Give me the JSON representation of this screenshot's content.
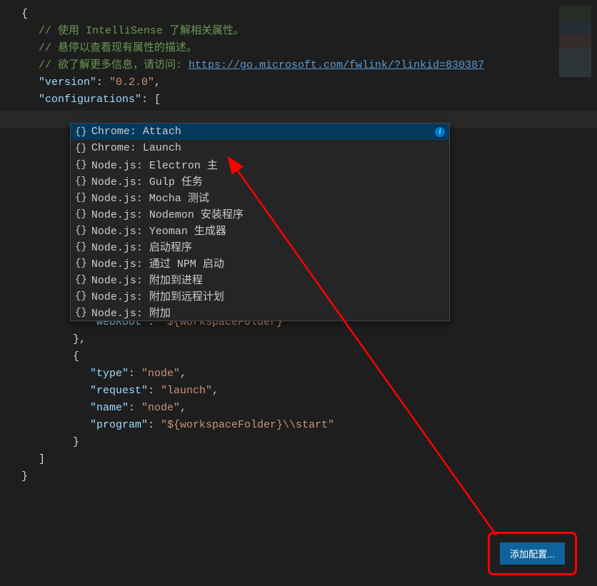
{
  "comments": {
    "line1": "// 使用 IntelliSense 了解相关属性。",
    "line2": "// 悬停以查看现有属性的描述。",
    "line3_prefix": "// 欲了解更多信息，请访问: ",
    "line3_link": "https://go.microsoft.com/fwlink/?linkid=830387"
  },
  "json_keys": {
    "version": "\"version\"",
    "version_val": "\"0.2.0\"",
    "configurations": "\"configurations\"",
    "webRoot": "\"webRoot\"",
    "webRoot_val": "\"${workspaceFolder}\"",
    "type": "\"type\"",
    "type_val": "\"node\"",
    "request": "\"request\"",
    "request_val": "\"launch\"",
    "name": "\"name\"",
    "name_val": "\"node\"",
    "program": "\"program\"",
    "program_val": "\"${workspaceFolder}\\\\start\""
  },
  "suggestions": [
    {
      "icon": "{}",
      "label": "Chrome: Attach",
      "selected": true
    },
    {
      "icon": "{}",
      "label": "Chrome: Launch"
    },
    {
      "icon": "{}",
      "label": "Node.js: Electron 主"
    },
    {
      "icon": "{}",
      "label": "Node.js: Gulp 任务"
    },
    {
      "icon": "{}",
      "label": "Node.js: Mocha 测试"
    },
    {
      "icon": "{}",
      "label": "Node.js: Nodemon 安装程序"
    },
    {
      "icon": "{}",
      "label": "Node.js: Yeoman 生成器"
    },
    {
      "icon": "{}",
      "label": "Node.js: 启动程序"
    },
    {
      "icon": "{}",
      "label": "Node.js: 通过 NPM 启动"
    },
    {
      "icon": "{}",
      "label": "Node.js: 附加到进程"
    },
    {
      "icon": "{}",
      "label": "Node.js: 附加到远程计划"
    },
    {
      "icon": "{}",
      "label": "Node.js: 附加"
    }
  ],
  "button": {
    "label": "添加配置..."
  }
}
